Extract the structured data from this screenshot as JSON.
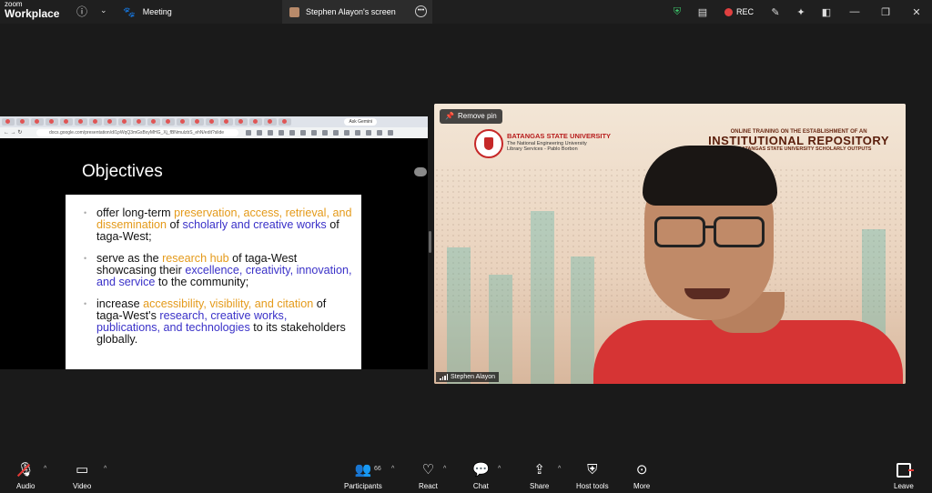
{
  "app": {
    "logo_line1": "zoom",
    "logo_line2": "Workplace"
  },
  "titlebar": {
    "meeting_tab": "Meeting",
    "share_tab": "Stephen Alayon's screen",
    "rec_label": "REC",
    "icons": [
      "info-icon",
      "chevron-down-icon",
      "paw-icon",
      "shield-check-icon",
      "document-icon",
      "cloud-record-icon",
      "wand-icon",
      "sparkle-icon",
      "pip-icon",
      "minimize-icon",
      "restore-icon",
      "close-icon"
    ]
  },
  "shared_screen": {
    "browser_tab_button": "Ask Gemini",
    "url": "docs.google.com/presentation/d/1pWqQ3mGsBxyMHG_Xj_fBNmulzbS_ehN/edit?slide",
    "slide": {
      "title": "Objectives",
      "bullets": [
        {
          "p1": "offer long-term ",
          "p2": "preservation, access, retrieval, and dissemination",
          "p3": " of ",
          "p4": "scholarly and creative works",
          "p5": " of taga-West;"
        },
        {
          "p1": "serve as the ",
          "p2": "research hub",
          "p3": " of taga-West showcasing their ",
          "p4": "excellence, creativity, innovation, and service",
          "p5": " to the community;"
        },
        {
          "p1": "increase ",
          "p2": "accessibility, visibility, and citation",
          "p3": " of taga-West's ",
          "p4": "research, creative works, publications, and technologies",
          "p5": " to its stakeholders globally."
        }
      ]
    }
  },
  "video": {
    "remove_pin": "Remove pin",
    "participant_name": "Stephen Alayon",
    "background": {
      "university": "BATANGAS STATE UNIVERSITY",
      "university_sub1": "The National Engineering University",
      "university_sub2": "Library Services - Pablo Borbon",
      "title_line1": "ONLINE TRAINING ON THE ESTABLISHMENT OF AN",
      "title_line2": "INSTITUTIONAL REPOSITORY",
      "title_line3": "FOR BATANGAS STATE UNIVERSITY SCHOLARLY OUTPUTS"
    }
  },
  "toolbar": {
    "audio": "Audio",
    "video": "Video",
    "participants": "Participants",
    "participants_count": "66",
    "react": "React",
    "chat": "Chat",
    "share": "Share",
    "host_tools": "Host tools",
    "more": "More",
    "leave": "Leave"
  }
}
